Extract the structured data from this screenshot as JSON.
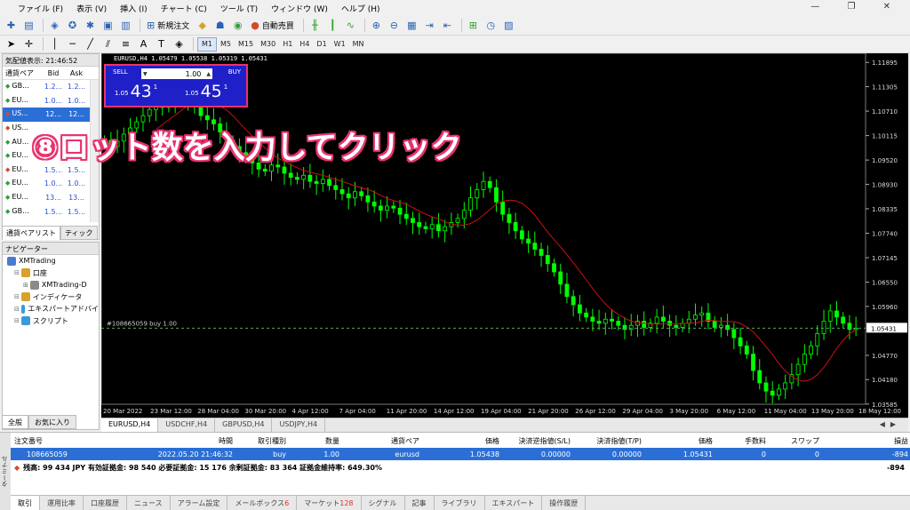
{
  "menu": [
    "ファイル (F)",
    "表示 (V)",
    "挿入 (I)",
    "チャート (C)",
    "ツール (T)",
    "ウィンドウ (W)",
    "ヘルプ (H)"
  ],
  "toolbar": {
    "new_order": "新規注文",
    "auto_trade": "自動売買",
    "notification_count": "1",
    "timeframes": [
      "M1",
      "M5",
      "M15",
      "M30",
      "H1",
      "H4",
      "D1",
      "W1",
      "MN"
    ],
    "selected_timeframe": "M1"
  },
  "market_watch": {
    "title": "気配値表示: 21:46:52",
    "headers": {
      "symbol": "通貨ペア",
      "bid": "Bid",
      "ask": "Ask"
    },
    "rows": [
      {
        "symbol": "GB...",
        "bid": "1.2...",
        "ask": "1.2...",
        "dir": "up"
      },
      {
        "symbol": "EU...",
        "bid": "1.0...",
        "ask": "1.0...",
        "dir": "up"
      },
      {
        "symbol": "US...",
        "bid": "12...",
        "ask": "12...",
        "dir": "down",
        "selected": true
      },
      {
        "symbol": "US...",
        "bid": "",
        "ask": "",
        "dir": "down"
      },
      {
        "symbol": "AU...",
        "bid": "",
        "ask": "",
        "dir": "up"
      },
      {
        "symbol": "EU...",
        "bid": "",
        "ask": "",
        "dir": "up"
      },
      {
        "symbol": "EU...",
        "bid": "1.5...",
        "ask": "1.5...",
        "dir": "down"
      },
      {
        "symbol": "EU...",
        "bid": "1.0...",
        "ask": "1.0...",
        "dir": "up"
      },
      {
        "symbol": "EU...",
        "bid": "13...",
        "ask": "13...",
        "dir": "up"
      },
      {
        "symbol": "GB...",
        "bid": "1.5...",
        "ask": "1.5...",
        "dir": "up"
      }
    ],
    "tabs": [
      "通貨ペアリスト",
      "ティック"
    ]
  },
  "navigator": {
    "title": "ナビゲーター",
    "items": [
      {
        "label": "XMTrading",
        "indent": 0,
        "color": "#4a7bd0"
      },
      {
        "label": "口座",
        "indent": 1,
        "color": "#d9a12b"
      },
      {
        "label": "XMTrading-D",
        "indent": 2,
        "color": "#8a8a8a"
      },
      {
        "label": "インディケータ",
        "indent": 1,
        "color": "#d9a12b"
      },
      {
        "label": "エキスパートアドバイ",
        "indent": 1,
        "color": "#3a9ad9"
      },
      {
        "label": "スクリプト",
        "indent": 1,
        "color": "#3a9ad9"
      }
    ],
    "tabs": [
      "全般",
      "お気に入り"
    ]
  },
  "chart": {
    "info": "EURUSD,H4  1.05479 1.05538 1.05319 1.05431",
    "order_line_label": "#108665059 buy 1.00",
    "current_price": "1.05431",
    "price_ticks": [
      "1.11895",
      "1.11305",
      "1.10710",
      "1.10115",
      "1.09520",
      "1.08930",
      "1.08335",
      "1.07740",
      "1.07145",
      "1.06550",
      "1.05960",
      "1.04770",
      "1.04180",
      "1.03585"
    ],
    "time_ticks": [
      "20 Mar 2022",
      "23 Mar 12:00",
      "28 Mar 04:00",
      "30 Mar 20:00",
      "4 Apr 12:00",
      "7 Apr 04:00",
      "11 Apr 20:00",
      "14 Apr 12:00",
      "19 Apr 04:00",
      "21 Apr 20:00",
      "26 Apr 12:00",
      "29 Apr 04:00",
      "3 May 20:00",
      "6 May 12:00",
      "11 May 04:00",
      "13 May 20:00",
      "18 May 12:00"
    ],
    "tabs": [
      "EURUSD,H4",
      "USDCHF,H4",
      "GBPUSD,H4",
      "USDJPY,H4"
    ]
  },
  "one_click": {
    "sell_label": "SELL",
    "buy_label": "BUY",
    "lot": "1.00",
    "sell_prefix": "1.05",
    "sell_big": "43",
    "sell_sup": "1",
    "buy_prefix": "1.05",
    "buy_big": "45",
    "buy_sup": "1"
  },
  "annotation": "⑧ロット数を入力してクリック",
  "terminal": {
    "side_label": "ターミナル",
    "headers": [
      "注文番号",
      "時間",
      "取引種別",
      "数量",
      "通貨ペア",
      "価格",
      "決済逆指値(S/L)",
      "決済指値(T/P)",
      "価格",
      "手数料",
      "スワップ",
      "損益"
    ],
    "row": [
      "108665059",
      "2022.05.20 21:46:32",
      "buy",
      "1.00",
      "eurusd",
      "1.05438",
      "0.00000",
      "0.00000",
      "1.05431",
      "0",
      "0",
      "-894"
    ],
    "balance_line": "残高: 99 434 JPY  有効証拠金: 98 540  必要証拠金: 15 176  余剰証拠金: 83 364  証拠金維持率: 649.30%",
    "balance_pl": "-894",
    "tabs": [
      {
        "label": "取引",
        "count": ""
      },
      {
        "label": "運用比率",
        "count": ""
      },
      {
        "label": "口座履歴",
        "count": ""
      },
      {
        "label": "ニュース",
        "count": ""
      },
      {
        "label": "アラーム設定",
        "count": ""
      },
      {
        "label": "メールボックス",
        "count": "6"
      },
      {
        "label": "マーケット",
        "count": "128"
      },
      {
        "label": "シグナル",
        "count": ""
      },
      {
        "label": "記事",
        "count": ""
      },
      {
        "label": "ライブラリ",
        "count": ""
      },
      {
        "label": "エキスパート",
        "count": ""
      },
      {
        "label": "操作履歴",
        "count": ""
      }
    ]
  },
  "colors": {
    "candle": "#00ff00",
    "ma": "#cc1010",
    "chart_bg": "#000000",
    "accent": "#e8336e",
    "selected_row": "#2b6fd6"
  },
  "candles_close": [
    1.1,
    1.0985,
    1.0998,
    1.1015,
    1.103,
    1.1045,
    1.106,
    1.1075,
    1.1095,
    1.108,
    1.109,
    1.111,
    1.1125,
    1.11,
    1.1085,
    1.106,
    1.105,
    1.104,
    1.102,
    1.1,
    1.0985,
    1.097,
    1.096,
    1.0945,
    1.093,
    1.0925,
    1.094,
    1.0935,
    1.092,
    1.091,
    1.0905,
    1.0915,
    1.09,
    1.0895,
    1.0905,
    1.089,
    1.088,
    1.087,
    1.086,
    1.0875,
    1.0865,
    1.085,
    1.084,
    1.083,
    1.084,
    1.0835,
    1.082,
    1.081,
    1.08,
    1.079,
    1.0785,
    1.0795,
    1.078,
    1.079,
    1.08,
    1.081,
    1.083,
    1.086,
    1.088,
    1.09,
    1.0885,
    1.085,
    1.082,
    1.08,
    1.078,
    1.076,
    1.075,
    1.0735,
    1.072,
    1.07,
    1.068,
    1.065,
    1.062,
    1.06,
    1.058,
    1.057,
    1.056,
    1.0555,
    1.0565,
    1.056,
    1.055,
    1.054,
    1.055,
    1.056,
    1.0545,
    1.0555,
    1.057,
    1.056,
    1.055,
    1.0545,
    1.0555,
    1.0565,
    1.0575,
    1.058,
    1.056,
    1.0545,
    1.055,
    1.054,
    1.052,
    1.05,
    1.048,
    1.044,
    1.041,
    1.039,
    1.038,
    1.0395,
    1.041,
    1.043,
    1.0455,
    1.048,
    1.05,
    1.053,
    1.056,
    1.0585,
    1.057,
    1.0555,
    1.054,
    1.0543
  ]
}
